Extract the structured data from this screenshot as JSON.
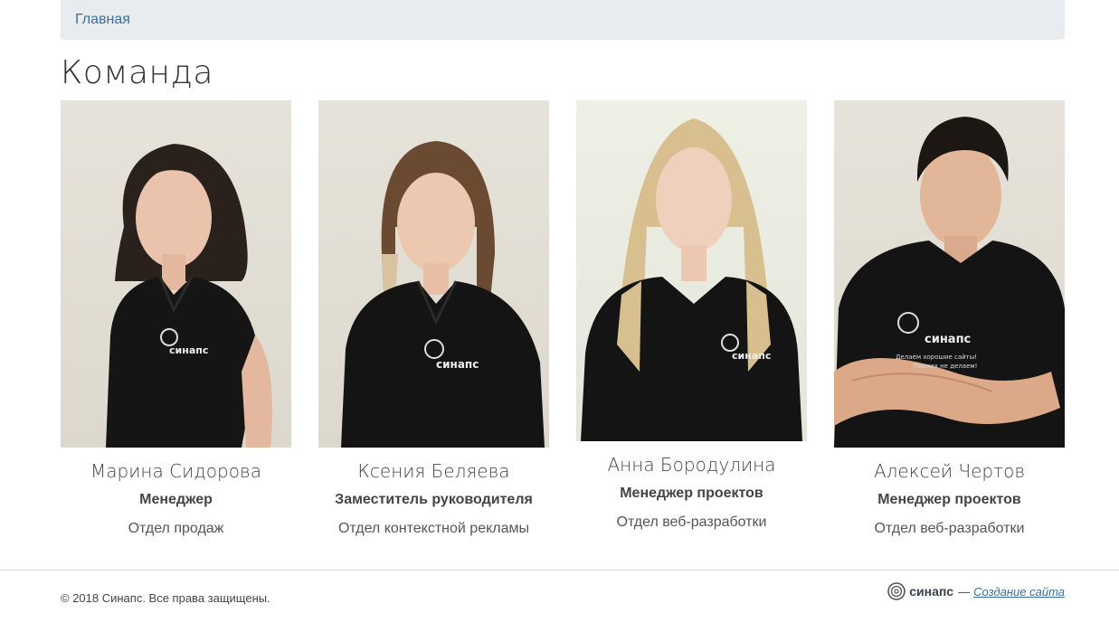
{
  "breadcrumb": {
    "home": "Главная"
  },
  "page": {
    "title": "Команда"
  },
  "team": [
    {
      "name": "Марина Сидорова",
      "role": "Менеджер",
      "department": "Отдел продаж"
    },
    {
      "name": "Ксения Беляева",
      "role": "Заместитель руководителя",
      "department": "Отдел контекстной рекламы"
    },
    {
      "name": "Анна Бородулина",
      "role": "Менеджер проектов",
      "department": "Отдел веб-разработки"
    },
    {
      "name": "Алексей Чертов",
      "role": "Менеджер проектов",
      "department": "Отдел веб-разработки"
    }
  ],
  "photo_logo_text": "синапс",
  "tshirt_slogan": [
    "Делаем хорошие сайты!",
    "Плохих не делаем!"
  ],
  "footer": {
    "copyright": "© 2018 Синапс. Все права защищены.",
    "logo_text": "синапс",
    "dash": "—",
    "link": "Создание сайта"
  },
  "colors": {
    "link": "#3a6ea5",
    "breadcrumb_bg": "#e9ecef",
    "text": "#333333"
  }
}
